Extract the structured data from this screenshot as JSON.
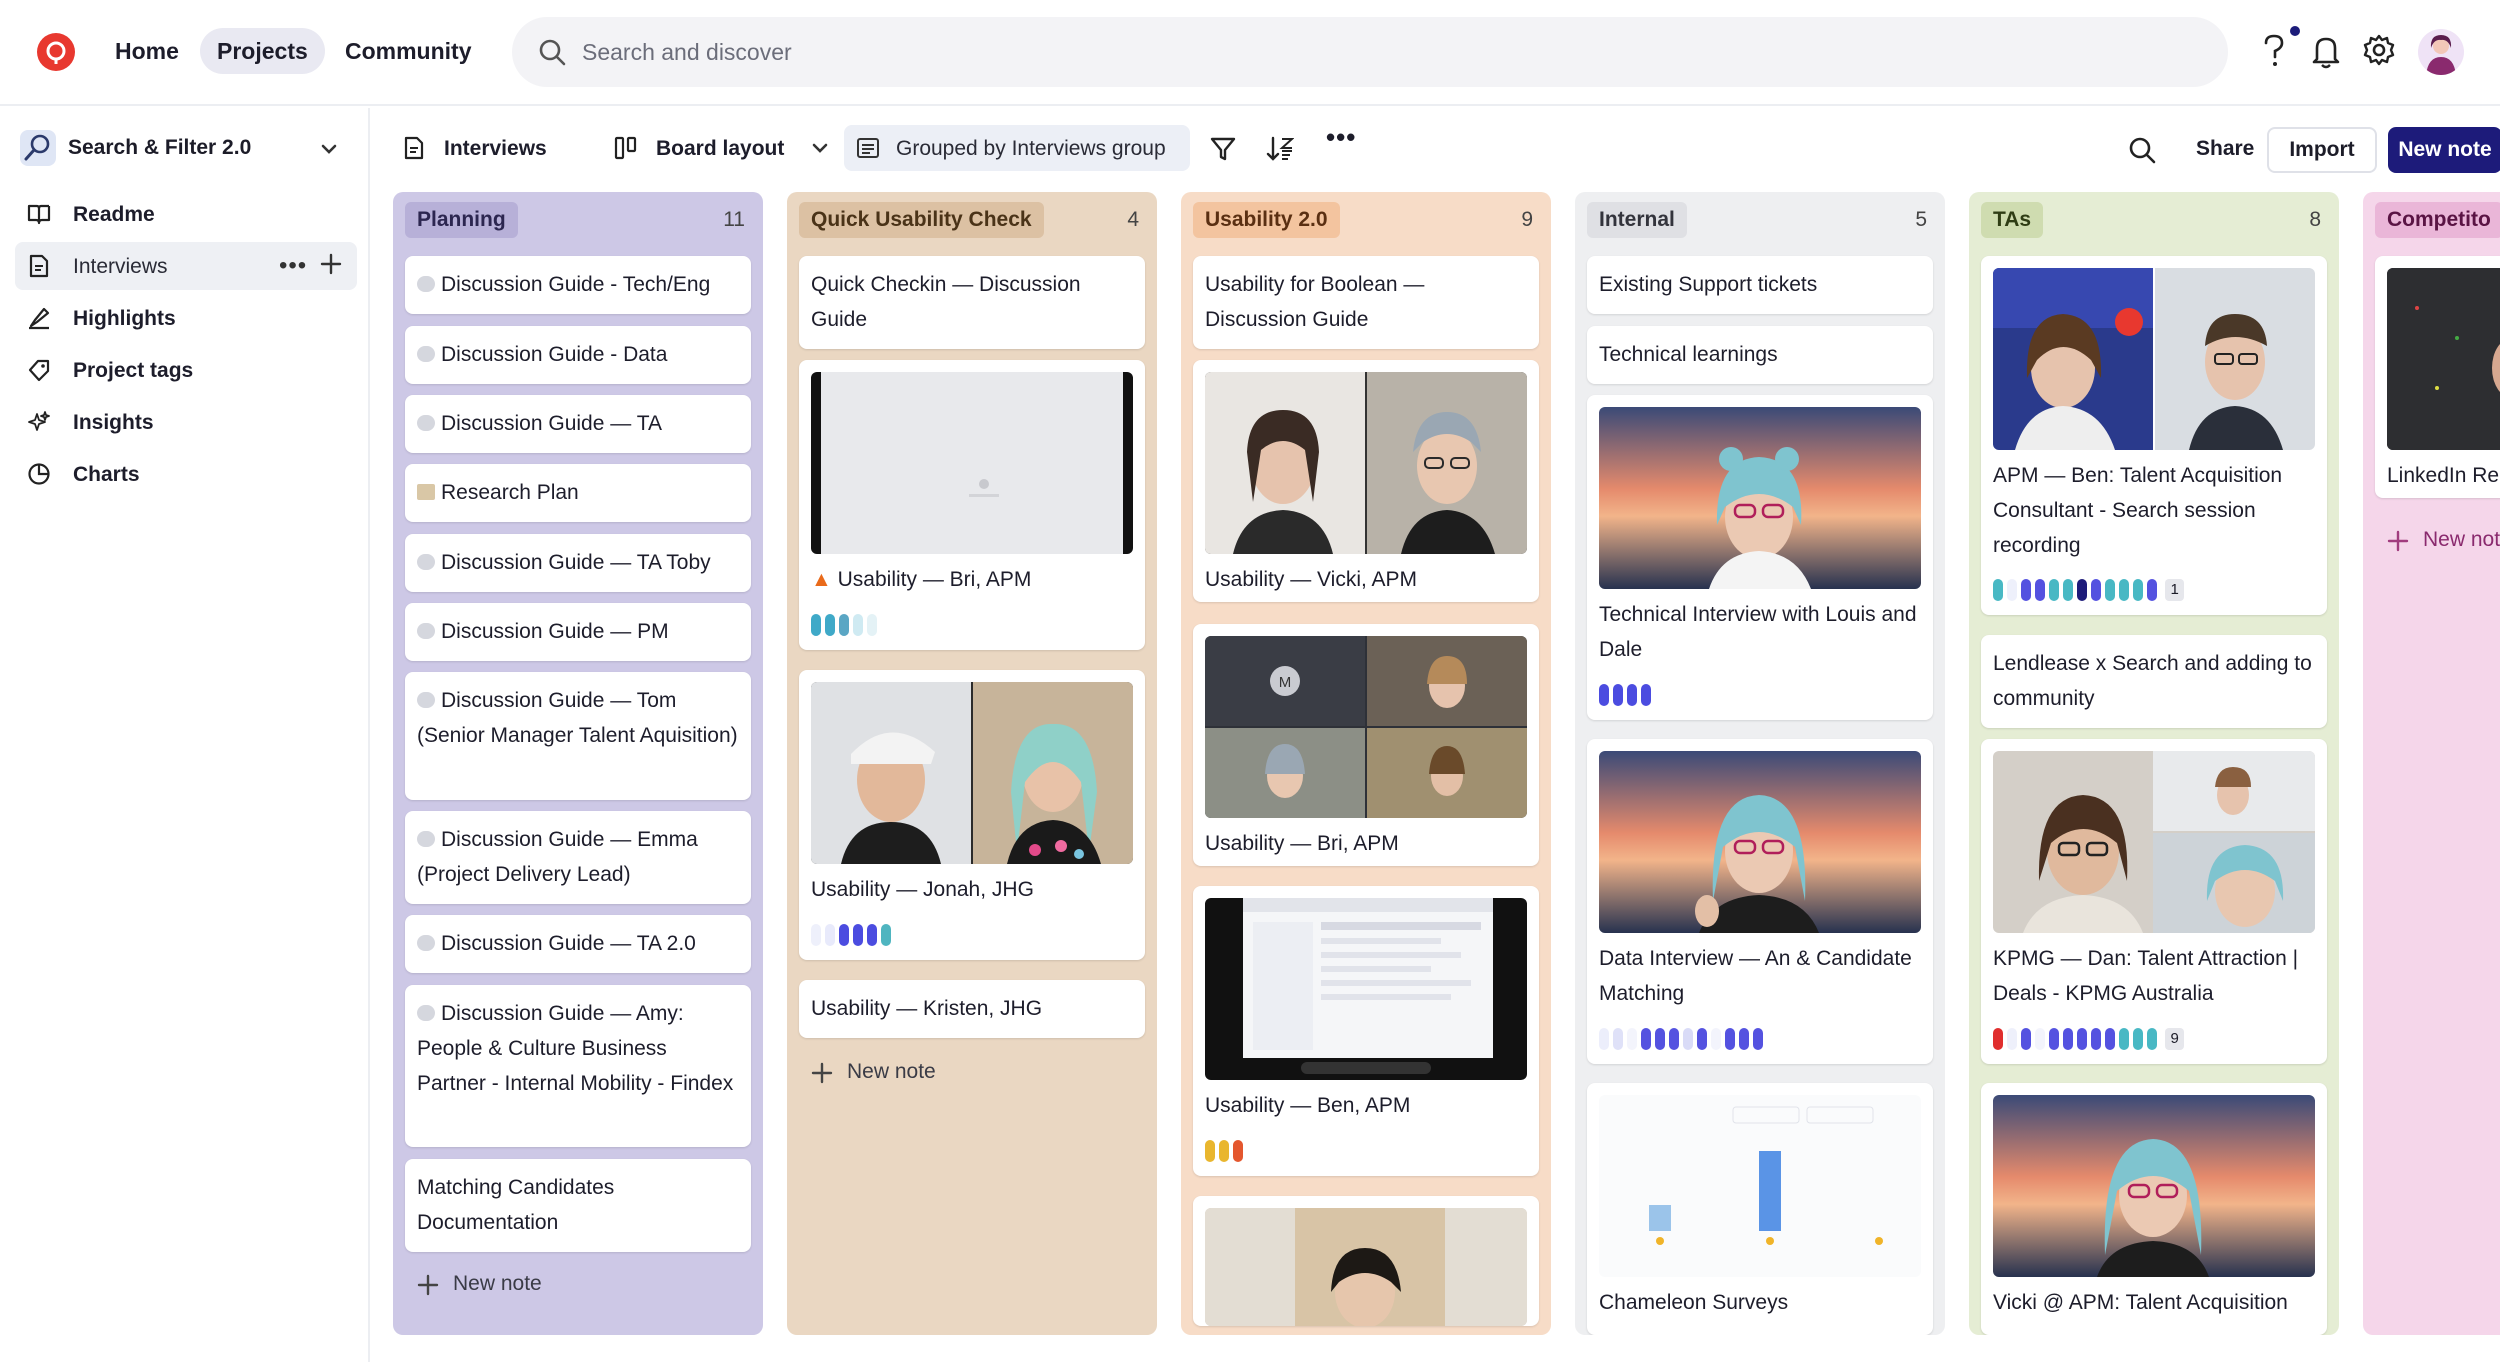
{
  "topnav": {
    "items": [
      "Home",
      "Projects",
      "Community"
    ],
    "search_placeholder": "Search and discover"
  },
  "sidebar": {
    "project_title": "Search & Filter 2.0",
    "items": [
      {
        "label": "Readme",
        "icon": "book-icon"
      },
      {
        "label": "Interviews",
        "icon": "document-icon"
      },
      {
        "label": "Highlights",
        "icon": "highlighter-icon"
      },
      {
        "label": "Project tags",
        "icon": "tag-icon"
      },
      {
        "label": "Insights",
        "icon": "sparkle-icon"
      },
      {
        "label": "Charts",
        "icon": "pie-chart-icon"
      }
    ]
  },
  "toolbar": {
    "view": "Interviews",
    "layout": "Board layout",
    "grouping": "Grouped by Interviews group",
    "share": "Share",
    "import": "Import",
    "new_note": "New note"
  },
  "colors": {
    "accent": "#1d1b7a",
    "logo": "#e8382f"
  },
  "board": {
    "new_note_label": "New note",
    "columns": [
      {
        "title": "Planning",
        "count": "11",
        "cards": [
          {
            "title": "Discussion Guide - Tech/Eng"
          },
          {
            "title": "Discussion Guide - Data"
          },
          {
            "title": "Discussion Guide — TA"
          },
          {
            "title": "Research Plan"
          },
          {
            "title": "Discussion Guide — TA Toby"
          },
          {
            "title": "Discussion Guide — PM"
          },
          {
            "title": "Discussion Guide — Tom (Senior Manager Talent Aquisition)"
          },
          {
            "title": "Discussion Guide — Emma (Project Delivery Lead)"
          },
          {
            "title": "Discussion Guide — TA 2.0"
          },
          {
            "title": "Discussion Guide — Amy: People & Culture Business Partner - Internal Mobility - Findex"
          },
          {
            "title": "Matching Candidates Documentation"
          }
        ]
      },
      {
        "title": "Quick Usability Check",
        "count": "4",
        "cards": [
          {
            "title": "Quick Checkin — Discussion Guide"
          },
          {
            "title": "Usability — Bri, APM"
          },
          {
            "title": "Usability — Jonah, JHG"
          },
          {
            "title": "Usability — Kristen, JHG"
          }
        ]
      },
      {
        "title": "Usability 2.0",
        "count": "9",
        "cards": [
          {
            "title": "Usability for Boolean — Discussion Guide"
          },
          {
            "title": "Usability — Vicki, APM"
          },
          {
            "title": "Usability — Bri, APM"
          },
          {
            "title": "Usability — Ben, APM"
          }
        ]
      },
      {
        "title": "Internal",
        "count": "5",
        "cards": [
          {
            "title": "Existing Support tickets"
          },
          {
            "title": "Technical learnings"
          },
          {
            "title": "Technical Interview with Louis and Dale"
          },
          {
            "title": "Data Interview — An & Candidate Matching"
          },
          {
            "title": "Chameleon Surveys"
          }
        ]
      },
      {
        "title": "TAs",
        "count": "8",
        "cards": [
          {
            "title": "APM — Ben: Talent Acquisition Consultant - Search session recording",
            "badge": "1"
          },
          {
            "title": "Lendlease x Search and adding to community"
          },
          {
            "title": "KPMG — Dan: Talent Attraction | Deals - KPMG Australia",
            "badge": "9"
          },
          {
            "title": "Vicki @ APM: Talent Acquisition"
          }
        ]
      },
      {
        "title": "Competito",
        "cards": [
          {
            "title": "LinkedIn Re"
          }
        ]
      }
    ]
  }
}
